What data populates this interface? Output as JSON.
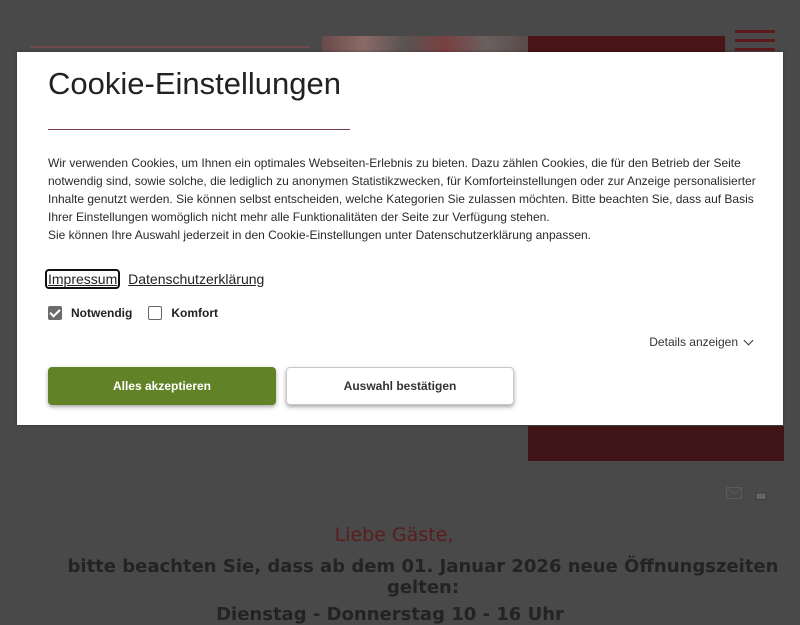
{
  "background": {
    "notice": {
      "greeting": "Liebe Gäste,",
      "line1": "bitte beachten Sie, dass ab dem 01. Januar 2026 neue Öffnungszeiten gelten:",
      "line2": "Dienstag - Donnerstag 10 - 16 Uhr"
    },
    "icons": [
      "menu-icon",
      "mail-icon",
      "print-icon"
    ]
  },
  "cookie_modal": {
    "title": "Cookie-Einstellungen",
    "body": [
      "Wir verwenden Cookies, um Ihnen ein optimales Webseiten-Erlebnis zu bieten. Dazu zählen Cookies, die für den Betrieb der Seite notwendig sind, sowie solche, die lediglich zu anonymen Statistikzwecken, für Komforteinstellungen oder zur Anzeige personalisierter Inhalte genutzt werden. Sie können selbst entscheiden, welche Kategorien Sie zulassen möchten. Bitte beachten Sie, dass auf Basis Ihrer Einstellungen womöglich nicht mehr alle Funktionalitäten der Seite zur Verfügung stehen.",
      "Sie können Ihre Auswahl jederzeit in den Cookie-Einstellungen unter Datenschutzerklärung anpassen."
    ],
    "links": {
      "impressum": "Impressum",
      "datenschutz": "Datenschutzerklärung"
    },
    "checkboxes": [
      {
        "label": "Notwendig",
        "checked": true
      },
      {
        "label": "Komfort",
        "checked": false
      }
    ],
    "details_label": "Details anzeigen",
    "buttons": {
      "accept_all": "Alles akzeptieren",
      "confirm": "Auswahl bestätigen"
    },
    "colors": {
      "accent": "#618226",
      "divider": "#7a3a45"
    }
  }
}
